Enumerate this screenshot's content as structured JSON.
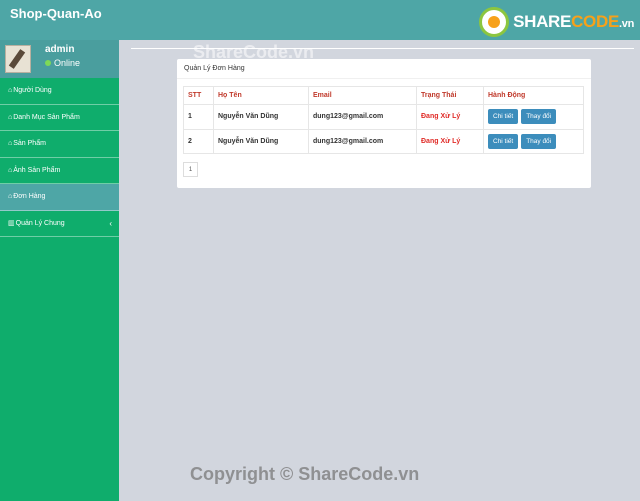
{
  "header": {
    "brand": "Shop-Quan-Ao",
    "logo": {
      "share": "SHARE",
      "code": "CODE",
      "vn": ".vn"
    }
  },
  "user": {
    "name": "admin",
    "status": "Online"
  },
  "sidebar": {
    "items": [
      {
        "label": "Người Dùng",
        "icon": "⌂"
      },
      {
        "label": "Danh Mục Sản Phẩm",
        "icon": "⌂"
      },
      {
        "label": "Sản Phẩm",
        "icon": "⌂"
      },
      {
        "label": "Ảnh Sản Phẩm",
        "icon": "⌂"
      },
      {
        "label": "Đơn Hàng",
        "icon": "⌂"
      },
      {
        "label": "Quản Lý Chung",
        "icon": "▥",
        "chevron": "‹"
      }
    ]
  },
  "box": {
    "title": "Quản Lý Đơn Hàng",
    "columns": [
      "STT",
      "Họ Tên",
      "Email",
      "Trạng Thái",
      "Hành Động"
    ],
    "rows": [
      {
        "stt": "1",
        "name": "Nguyễn Văn Dũng",
        "email": "dung123@gmail.com",
        "status": "Đang Xử Lý",
        "detail": "Chi tiết",
        "change": "Thay đổi"
      },
      {
        "stt": "2",
        "name": "Nguyễn Văn Dũng",
        "email": "dung123@gmail.com",
        "status": "Đang Xử Lý",
        "detail": "Chi tiết",
        "change": "Thay đổi"
      }
    ],
    "page": "1"
  },
  "watermark": {
    "top": "ShareCode.vn",
    "bottom": "Copyright © ShareCode.vn"
  }
}
